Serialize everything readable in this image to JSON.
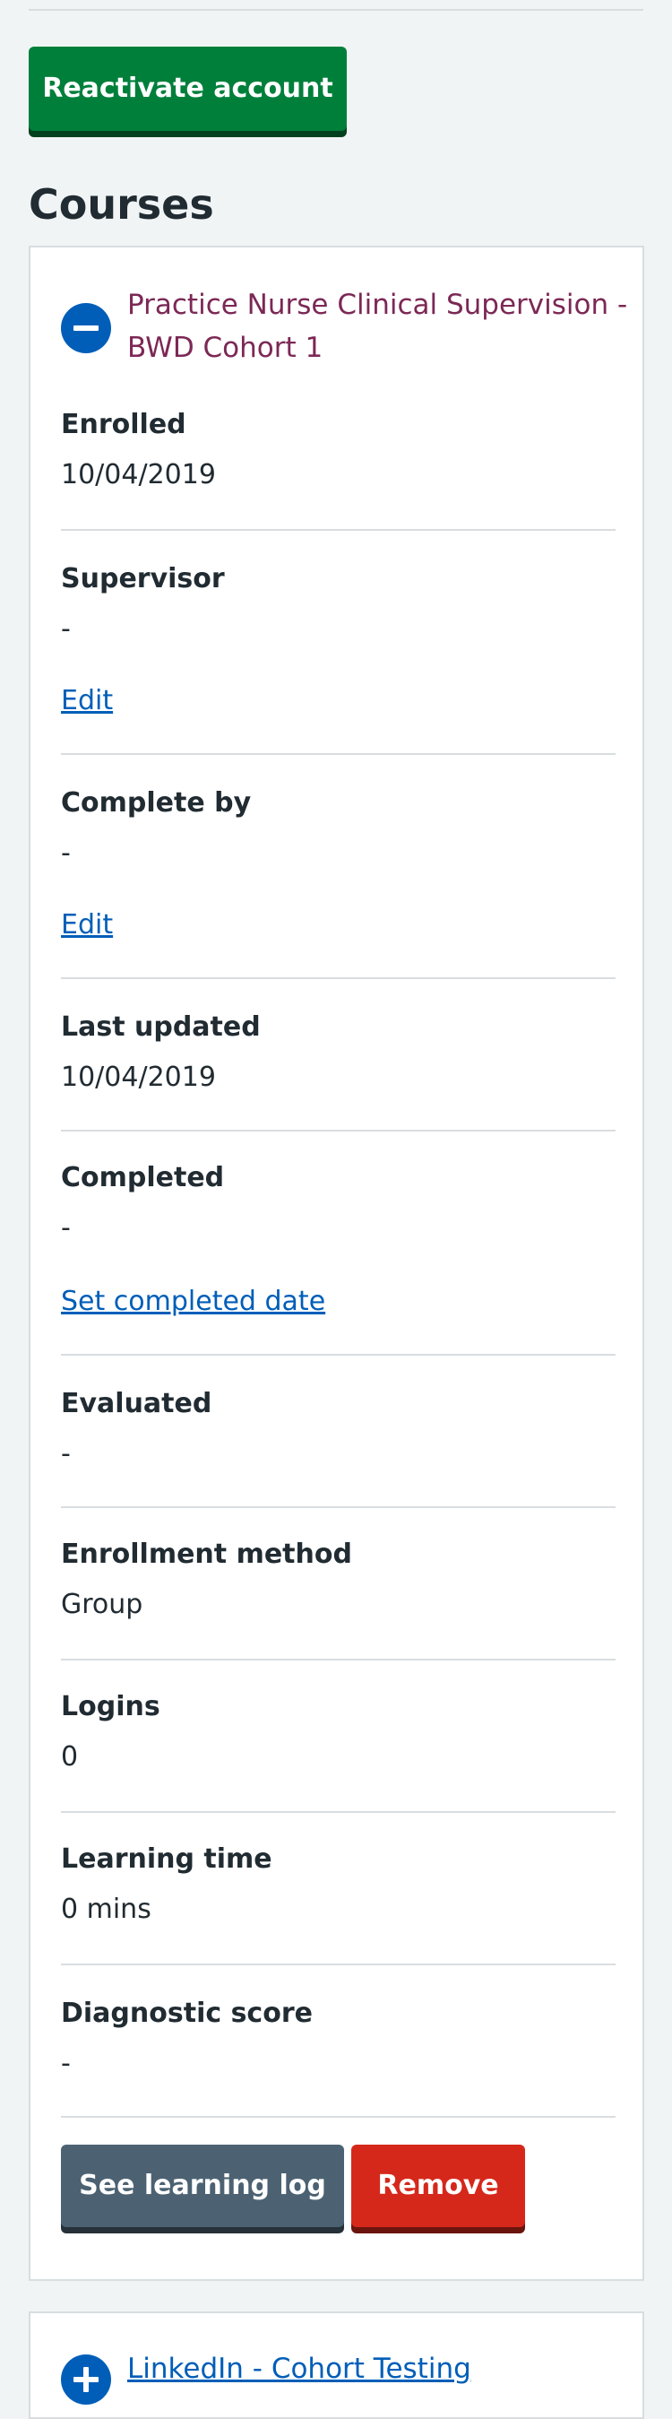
{
  "actions": {
    "reactivate_label": "Reactivate account"
  },
  "courses_heading": "Courses",
  "course": {
    "title": "Practice Nurse Clinical Supervision - BWD Cohort 1",
    "expand_icon": "minus-circle-icon",
    "fields": {
      "enrolled": {
        "label": "Enrolled",
        "value": "10/04/2019"
      },
      "supervisor": {
        "label": "Supervisor",
        "value": "-",
        "action": "Edit"
      },
      "complete_by": {
        "label": "Complete by",
        "value": "-",
        "action": "Edit"
      },
      "last_updated": {
        "label": "Last updated",
        "value": "10/04/2019"
      },
      "completed": {
        "label": "Completed",
        "value": "-",
        "action": "Set completed date"
      },
      "evaluated": {
        "label": "Evaluated",
        "value": "-"
      },
      "enrollment_method": {
        "label": "Enrollment method",
        "value": "Group"
      },
      "logins": {
        "label": "Logins",
        "value": "0"
      },
      "learning_time": {
        "label": "Learning time",
        "value": "0 mins"
      },
      "diagnostic_score": {
        "label": "Diagnostic score",
        "value": "-"
      }
    },
    "buttons": {
      "learning_log": "See learning log",
      "remove": "Remove"
    }
  },
  "course2": {
    "title": "LinkedIn - Cohort Testing",
    "expand_icon": "plus-circle-icon"
  },
  "colors": {
    "page_bg": "#f0f4f5",
    "primary_green": "#007f3b",
    "link_blue": "#005eb8",
    "course_title_plum": "#7c2855",
    "secondary_grey": "#4c6272",
    "danger_red": "#d5281b"
  }
}
